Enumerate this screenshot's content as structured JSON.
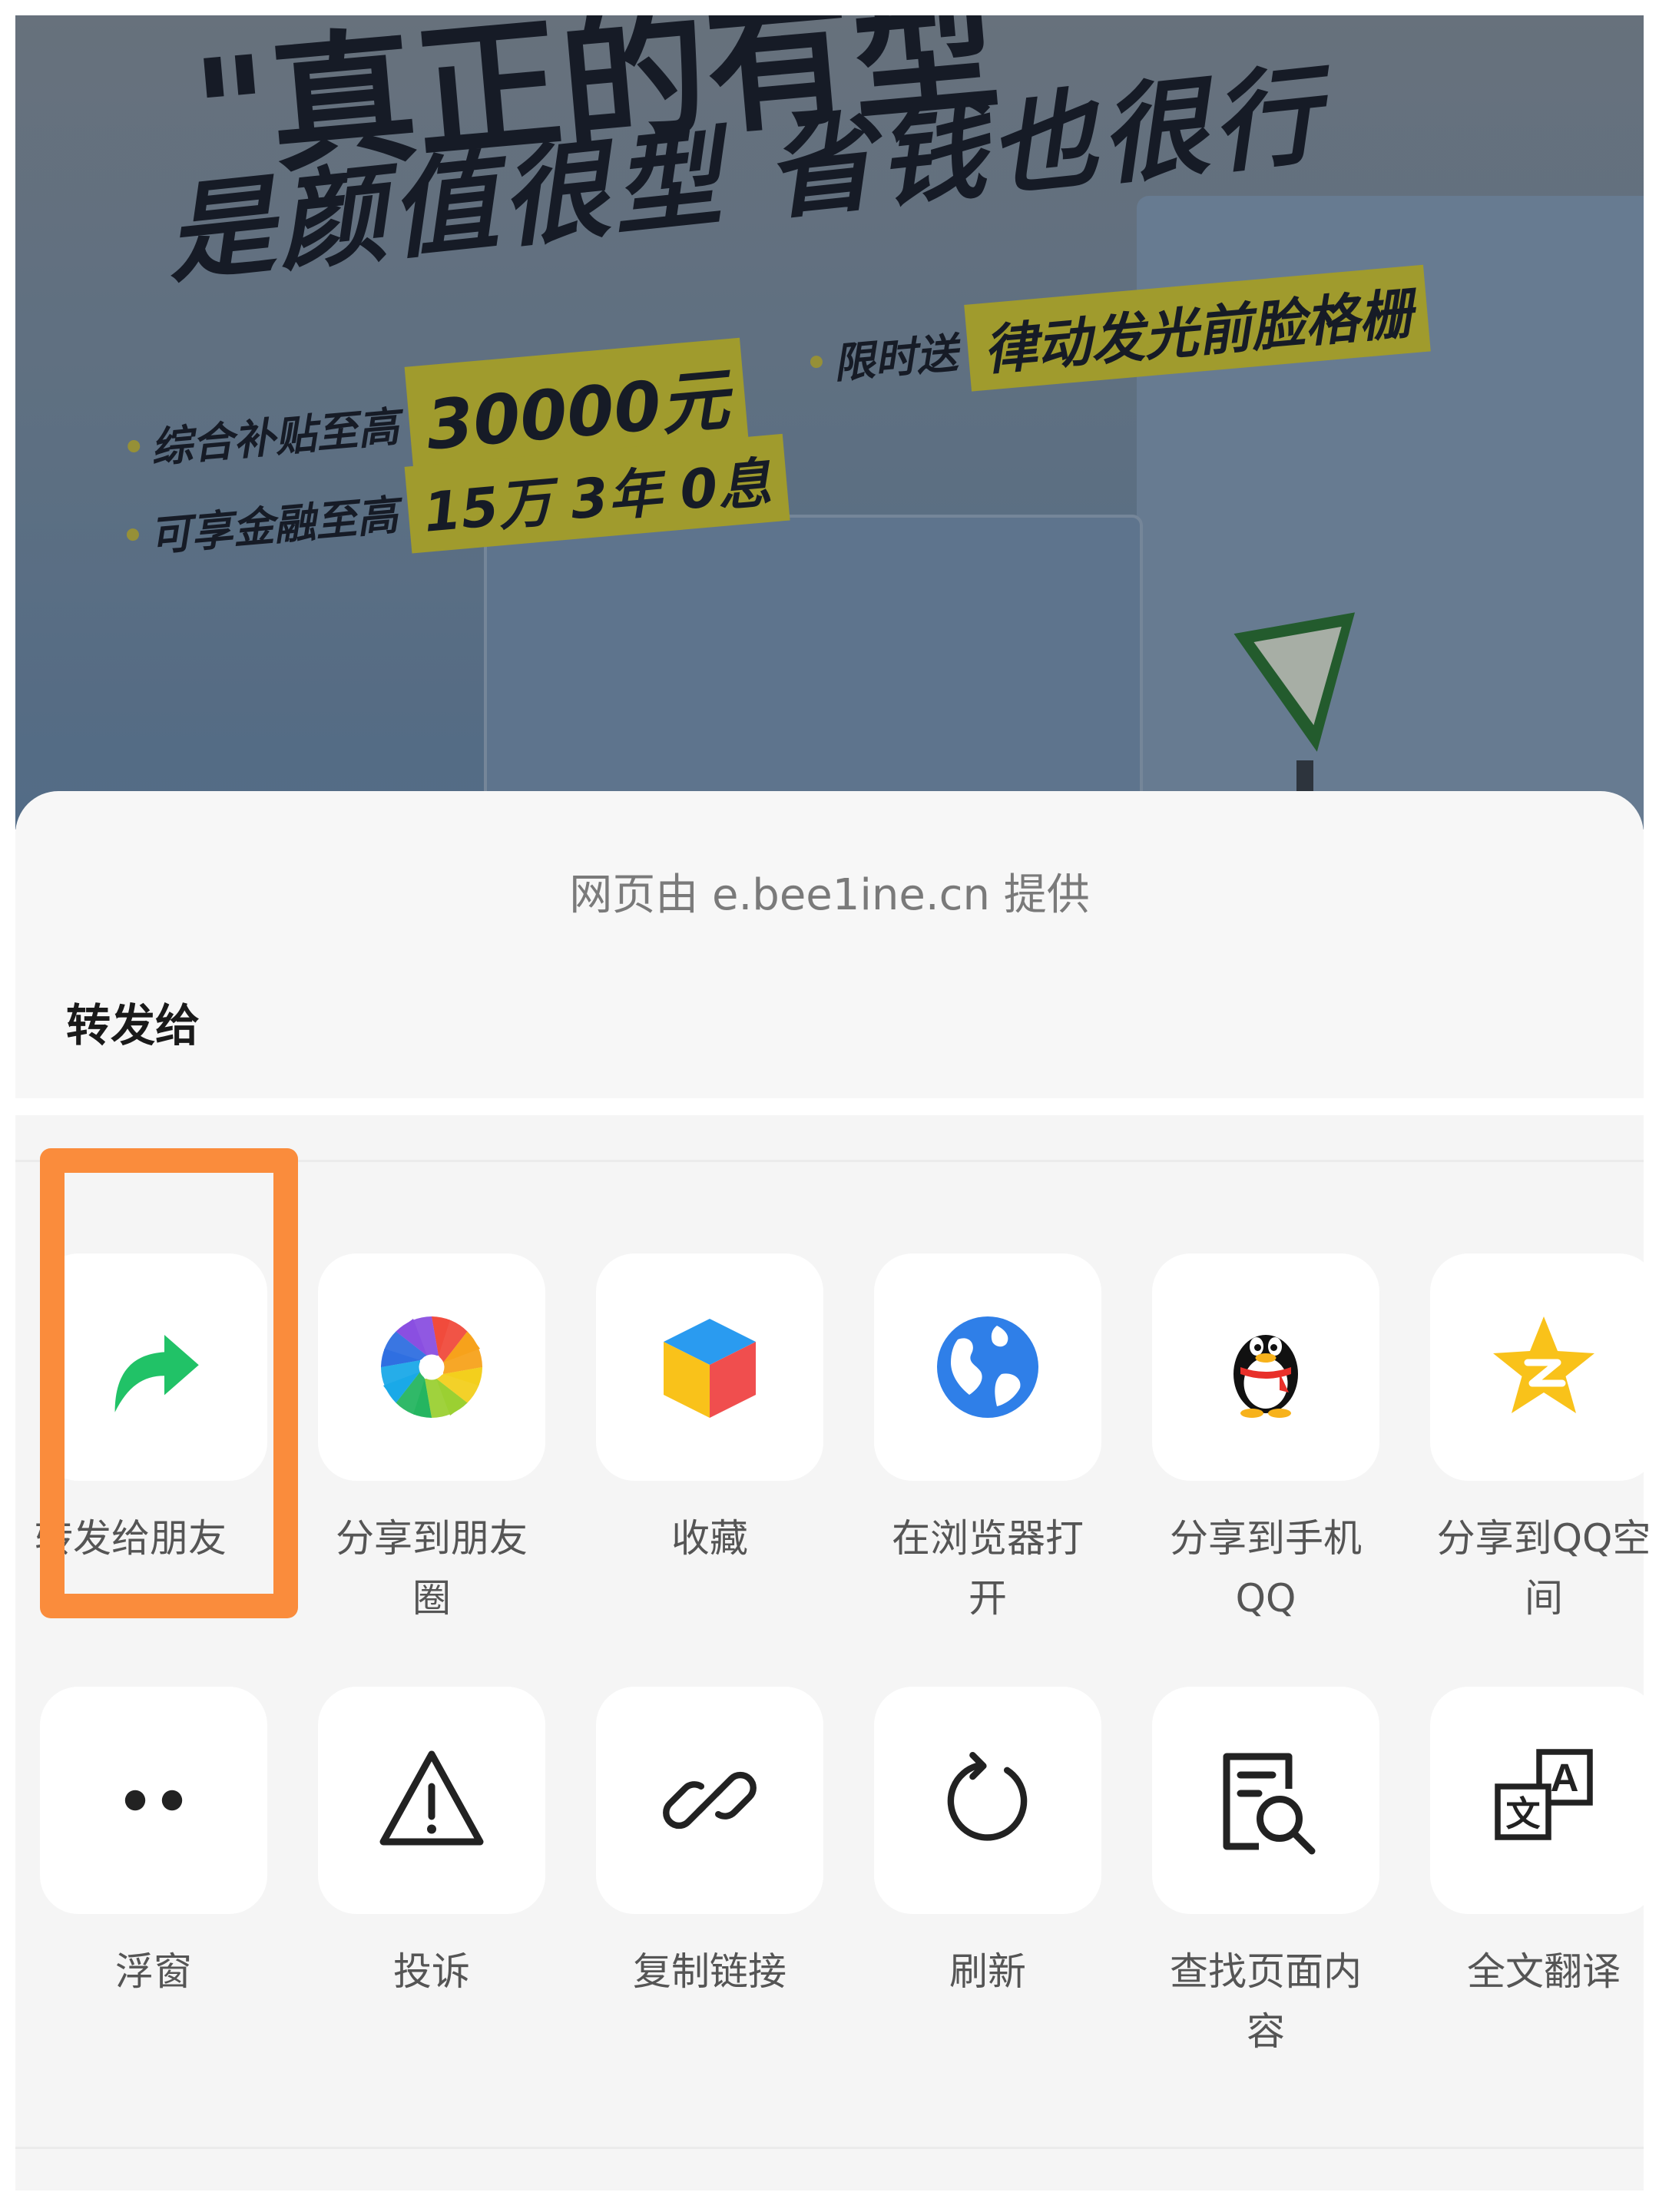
{
  "ad": {
    "headline_top": "\"真正的有型",
    "headline": "是颜值很型 省钱也很行",
    "row1_label": "综合补贴至高",
    "row1_value": "30000元",
    "row1b_label": "限时送",
    "row1b_value": "律动发光前脸格栅",
    "row2_label": "可享金融至高",
    "row2_value": "15万 3年 0息"
  },
  "sheet": {
    "provider": "网页由 e.bee1ine.cn 提供",
    "section_title": "转发给"
  },
  "actions_row1": [
    {
      "label": "转发给朋友",
      "icon": "forward-arrow-icon"
    },
    {
      "label": "分享到朋友\n圈",
      "icon": "moments-aperture-icon"
    },
    {
      "label": "收藏",
      "icon": "favorites-cube-icon"
    },
    {
      "label": "在浏览器打\n开",
      "icon": "browser-globe-icon"
    },
    {
      "label": "分享到手机\nQQ",
      "icon": "qq-penguin-icon"
    },
    {
      "label": "分享到QQ空\n间",
      "icon": "qzone-star-icon"
    }
  ],
  "actions_row2": [
    {
      "label": "浮窗",
      "icon": "float-window-icon"
    },
    {
      "label": "投诉",
      "icon": "warning-icon"
    },
    {
      "label": "复制链接",
      "icon": "link-icon"
    },
    {
      "label": "刷新",
      "icon": "refresh-icon"
    },
    {
      "label": "查找页面内\n容",
      "icon": "find-in-page-icon"
    },
    {
      "label": "全文翻译",
      "icon": "translate-icon"
    }
  ],
  "colors": {
    "highlight_border": "#fa8c3c",
    "forward_green": "#21c267",
    "sheet_bg": "#f5f5f5"
  }
}
